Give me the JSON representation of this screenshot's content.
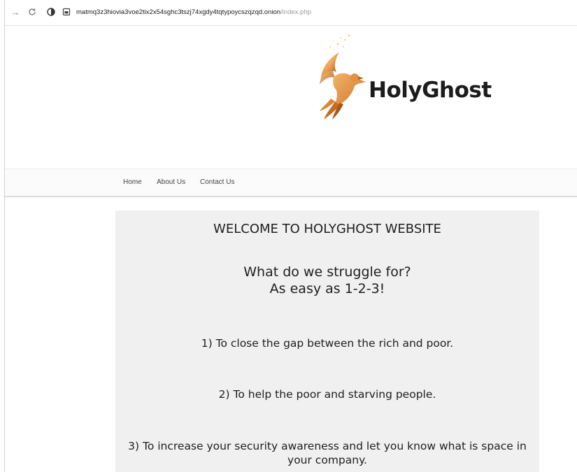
{
  "browser": {
    "url_host": "matmq3z3hiovia3voe2tix2x54sghc3tszj74xgdy4tqtypoycszqzqd.onion",
    "url_path": "/index.php",
    "icons": [
      "back-arrow-icon",
      "reload-icon",
      "privacy-shield-icon",
      "page-icon"
    ]
  },
  "header": {
    "logo_text": "HolyGhost",
    "logo_colors": [
      "#f6c98a",
      "#e8953a",
      "#b8651c"
    ]
  },
  "nav": {
    "items": [
      "Home",
      "About Us",
      "Contact Us"
    ]
  },
  "main": {
    "welcome": "WELCOME TO HOLYGHOST WEBSITE",
    "struggle_line1": "What do we struggle for?",
    "struggle_line2": "As easy as 1-2-3!",
    "points": [
      "1) To close the gap between the rich and poor.",
      "2) To help the poor and starving people.",
      "3) To increase your security awareness and let you know what is space in your company."
    ]
  }
}
